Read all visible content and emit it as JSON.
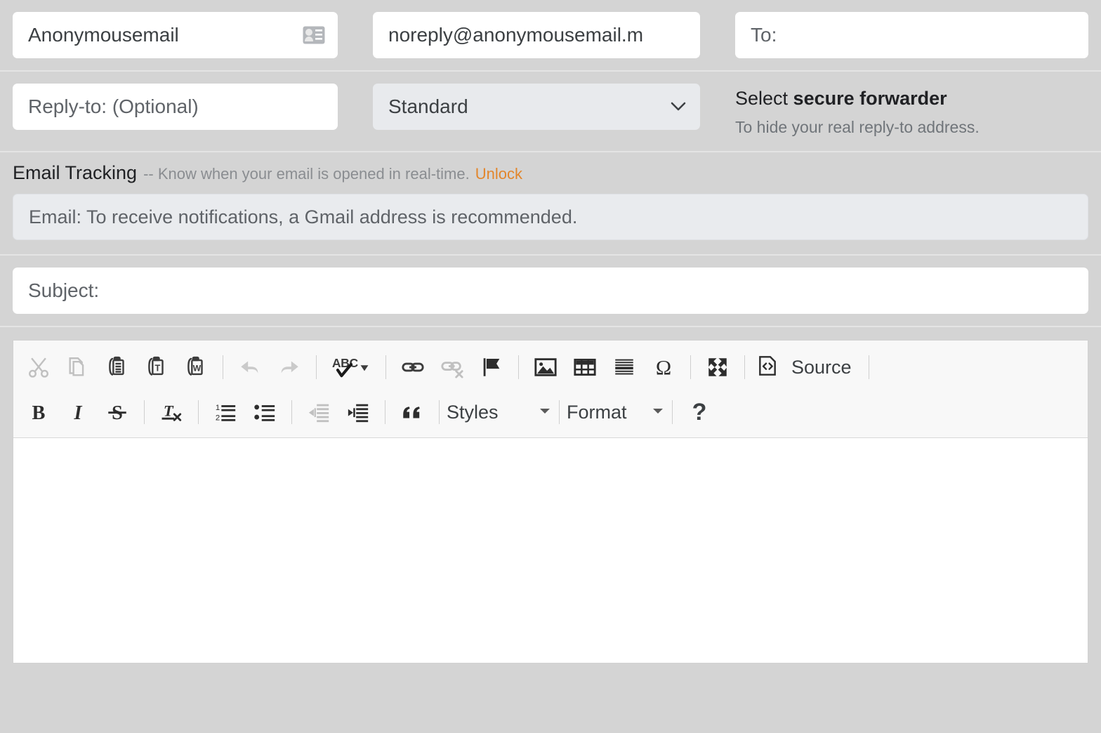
{
  "compose": {
    "from": {
      "value": "Anonymousemail",
      "icon": "contact-card-icon"
    },
    "from_address": {
      "value": "noreply@anonymousemail.m"
    },
    "to": {
      "placeholder": "To:"
    },
    "reply_to": {
      "placeholder": "Reply-to: (Optional)"
    },
    "delivery_select": {
      "value": "Standard",
      "options": [
        "Standard"
      ]
    },
    "forwarder_info": {
      "title_prefix": "Select ",
      "title_bold": "secure forwarder",
      "subtitle": "To hide your real reply-to address."
    },
    "tracking": {
      "title": "Email Tracking",
      "description": "-- Know when your email is opened in real-time.",
      "unlock_label": "Unlock",
      "unlock_color": "#e2862c",
      "email_placeholder": "Email: To receive notifications, a Gmail address is recommended."
    },
    "subject": {
      "placeholder": "Subject:"
    }
  },
  "editor": {
    "toolbar_row1": [
      {
        "name": "cut-icon",
        "label": "Cut",
        "disabled": true
      },
      {
        "name": "copy-icon",
        "label": "Copy",
        "disabled": true
      },
      {
        "name": "paste-icon",
        "label": "Paste",
        "disabled": false
      },
      {
        "name": "paste-as-text-icon",
        "label": "Paste as plain text",
        "disabled": false
      },
      {
        "name": "paste-from-word-icon",
        "label": "Paste from Word",
        "disabled": false
      },
      {
        "name": "undo-icon",
        "label": "Undo",
        "disabled": true
      },
      {
        "name": "redo-icon",
        "label": "Redo",
        "disabled": true
      },
      {
        "name": "spell-check-icon",
        "label": "Check Spelling",
        "disabled": false
      },
      {
        "name": "link-icon",
        "label": "Link",
        "disabled": false
      },
      {
        "name": "unlink-icon",
        "label": "Unlink",
        "disabled": true
      },
      {
        "name": "anchor-flag-icon",
        "label": "Anchor",
        "disabled": false
      },
      {
        "name": "image-icon",
        "label": "Image",
        "disabled": false
      },
      {
        "name": "table-icon",
        "label": "Table",
        "disabled": false
      },
      {
        "name": "horizontal-rule-icon",
        "label": "Horizontal Line",
        "disabled": false
      },
      {
        "name": "special-character-icon",
        "label": "Insert Special Character",
        "disabled": false
      },
      {
        "name": "maximize-icon",
        "label": "Maximize",
        "disabled": false
      },
      {
        "name": "source-icon",
        "label": "Source",
        "disabled": false
      }
    ],
    "source_label": "Source",
    "toolbar_row2": [
      {
        "name": "bold-icon",
        "label": "Bold",
        "disabled": false
      },
      {
        "name": "italic-icon",
        "label": "Italic",
        "disabled": false
      },
      {
        "name": "strikethrough-icon",
        "label": "Strikethrough",
        "disabled": false
      },
      {
        "name": "remove-format-icon",
        "label": "Remove Format",
        "disabled": false
      },
      {
        "name": "numbered-list-icon",
        "label": "Insert/Remove Numbered List",
        "disabled": false
      },
      {
        "name": "bulleted-list-icon",
        "label": "Insert/Remove Bulleted List",
        "disabled": false
      },
      {
        "name": "outdent-icon",
        "label": "Decrease Indent",
        "disabled": true
      },
      {
        "name": "indent-icon",
        "label": "Increase Indent",
        "disabled": false
      },
      {
        "name": "blockquote-icon",
        "label": "Block Quote",
        "disabled": false
      }
    ],
    "styles_label": "Styles",
    "format_label": "Format",
    "help_label": "?",
    "body_content": ""
  }
}
